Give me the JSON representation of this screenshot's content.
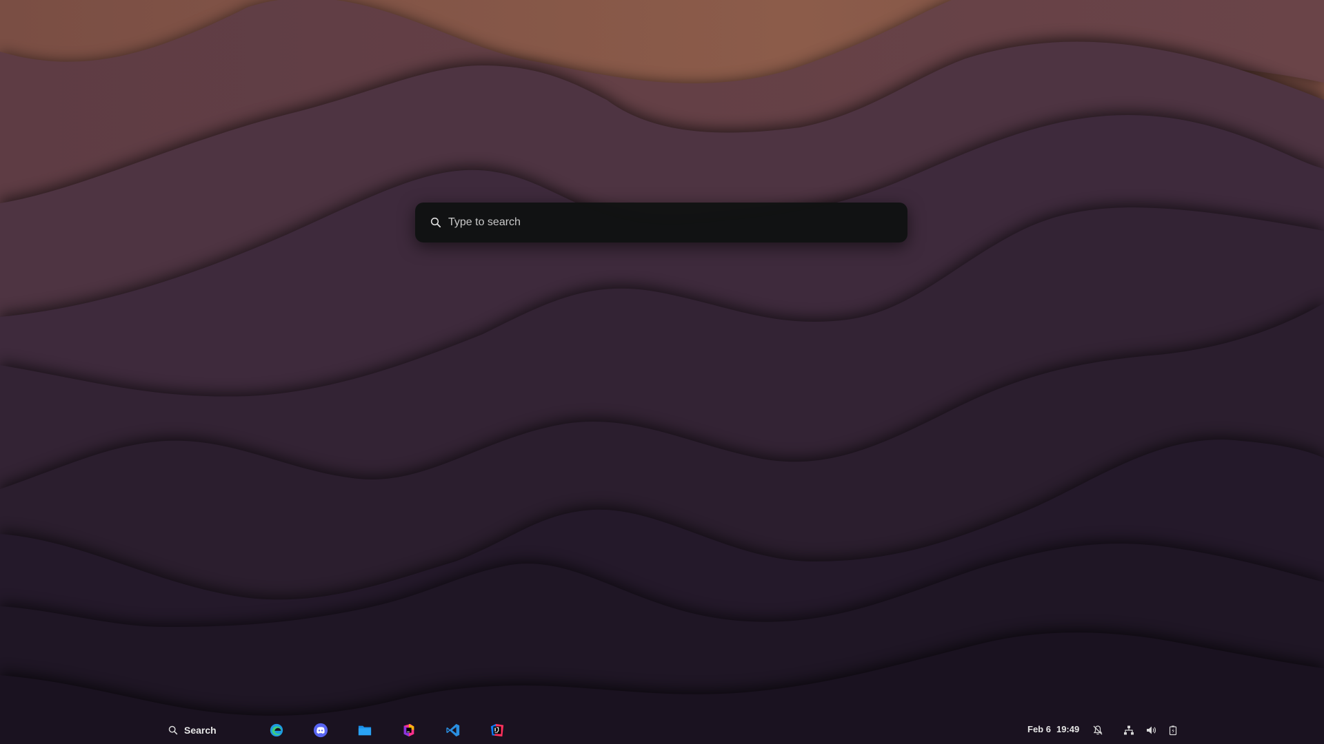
{
  "search_overlay": {
    "placeholder": "Type to search",
    "icon": "search-icon"
  },
  "taskbar": {
    "search_label": "Search",
    "apps": [
      {
        "name": "Microsoft Edge",
        "icon": "edge-icon"
      },
      {
        "name": "Discord",
        "icon": "discord-icon"
      },
      {
        "name": "Files",
        "icon": "folder-icon"
      },
      {
        "name": "JetBrains Toolbox",
        "icon": "jetbrains-toolbox-icon"
      },
      {
        "name": "Visual Studio Code",
        "icon": "vscode-icon"
      },
      {
        "name": "IntelliJ IDEA",
        "icon": "intellij-icon"
      }
    ],
    "date": "Feb 6",
    "time": "19:49",
    "tray": [
      "notifications-off-icon",
      "network-icon",
      "volume-icon",
      "battery-icon"
    ]
  },
  "colors": {
    "overlay_bg": "#101212",
    "text": "#e6e6e6",
    "edge_blue": "#1e9be0",
    "discord_blurple": "#5865f2",
    "folder_blue": "#1a8fe8",
    "vscode_blue": "#2a8fe0"
  }
}
